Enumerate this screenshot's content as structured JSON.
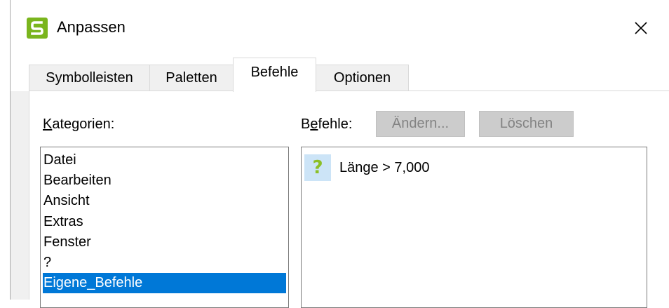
{
  "window": {
    "title": "Anpassen",
    "app_icon": "s-logo-icon",
    "close_icon": "close-icon",
    "accent_color": "#7ab51d"
  },
  "tabs": [
    {
      "label": "Symbolleisten",
      "active": false
    },
    {
      "label": "Paletten",
      "active": false
    },
    {
      "label": "Befehle",
      "active": true
    },
    {
      "label": "Optionen",
      "active": false
    }
  ],
  "categories": {
    "label_pre": "",
    "label_accel": "K",
    "label_post": "ategorien:",
    "items": [
      "Datei",
      "Bearbeiten",
      "Ansicht",
      "Extras",
      "Fenster",
      "?",
      "Eigene_Befehle"
    ],
    "selected": "Eigene_Befehle"
  },
  "commands": {
    "label_pre": "B",
    "label_accel": "e",
    "label_post": "fehle:",
    "change_button": "Ändern...",
    "delete_button": "Löschen",
    "items": [
      {
        "icon": "question-mark-icon",
        "icon_glyph": "?",
        "label": "Länge > 7,000"
      }
    ]
  },
  "colors": {
    "selection": "#0078d7",
    "command_icon_bg": "#cce4f7",
    "command_icon_fg": "#8cbf26"
  }
}
